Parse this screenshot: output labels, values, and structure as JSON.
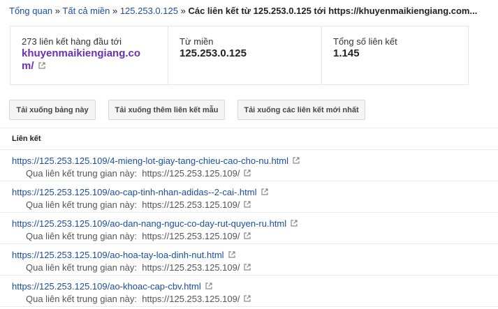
{
  "breadcrumb": {
    "items": [
      "Tổng quan",
      "Tất cả miền",
      "125.253.0.125"
    ],
    "separator": "»",
    "current": "Các liên kết từ 125.253.0.125 tới https://khuyenmaikiengiang.com..."
  },
  "stats": {
    "top_links": {
      "label": "273 liên kết hàng đầu tới",
      "domain_line1": "khuyenmaikiengiang.co",
      "domain_line2": "m/"
    },
    "from_domain": {
      "label": "Từ miền",
      "value": "125.253.0.125"
    },
    "total_links": {
      "label": "Tổng số liên kết",
      "value": "1.145"
    }
  },
  "buttons": {
    "download_table": "Tải xuống bảng này",
    "download_more_samples": "Tải xuống thêm liên kết mẫu",
    "download_latest": "Tải xuống các liên kết mới nhất"
  },
  "table": {
    "column_header": "Liên kết",
    "via_label": "Qua liên kết trung gian này:",
    "rows": [
      {
        "url": "https://125.253.125.109/4-mieng-lot-giay-tang-chieu-cao-cho-nu.html",
        "via": "https://125.253.125.109/"
      },
      {
        "url": "https://125.253.125.109/ao-cap-tinh-nhan-adidas--2-cai-.html",
        "via": "https://125.253.125.109/"
      },
      {
        "url": "https://125.253.125.109/ao-dan-nang-nguc-co-day-rut-quyen-ru.html",
        "via": "https://125.253.125.109/"
      },
      {
        "url": "https://125.253.125.109/ao-hoa-tay-loa-dinh-nut.html",
        "via": "https://125.253.125.109/"
      },
      {
        "url": "https://125.253.125.109/ao-khoac-cap-cbv.html",
        "via": "https://125.253.125.109/"
      }
    ]
  },
  "colors": {
    "link": "#1a4fa0",
    "domain": "#6b2fb3",
    "border": "#e5e5e5"
  },
  "icons": {
    "external": "external-link-icon"
  }
}
